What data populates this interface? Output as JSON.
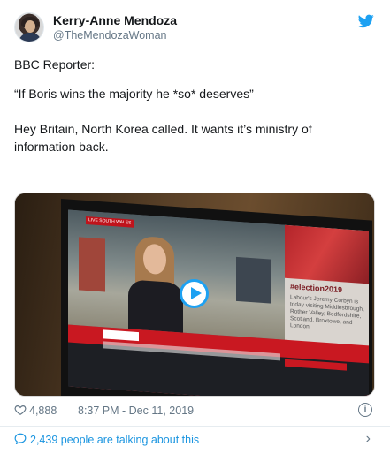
{
  "author": {
    "name": "Kerry-Anne Mendoza",
    "handle": "@TheMendozaWoman"
  },
  "tweet": {
    "line1": "BBC Reporter:",
    "line2": "“If Boris wins the majority he *so* deserves”",
    "line3": "Hey Britain, North Korea called. It wants it’s ministry of information back."
  },
  "video": {
    "hashtag": "#election2019",
    "side_text": "Labour's Jeremy Corbyn is today visiting Middlesbrough, Rother Valley, Bedfordshire, Scotland, Broxtowe, and London",
    "live_label": "LIVE SOUTH WALES"
  },
  "meta": {
    "likes": "4,888",
    "timestamp": "8:37 PM - Dec 11, 2019",
    "info_glyph": "i"
  },
  "footer": {
    "talking": "2,439 people are talking about this",
    "chevron": "›"
  },
  "colors": {
    "link": "#1b95e0",
    "twitter_blue": "#1da1f2",
    "muted": "#657786"
  },
  "icons": [
    "twitter-bird-icon",
    "play-icon",
    "heart-icon",
    "info-icon",
    "comment-bubble-icon",
    "chevron-right-icon"
  ]
}
